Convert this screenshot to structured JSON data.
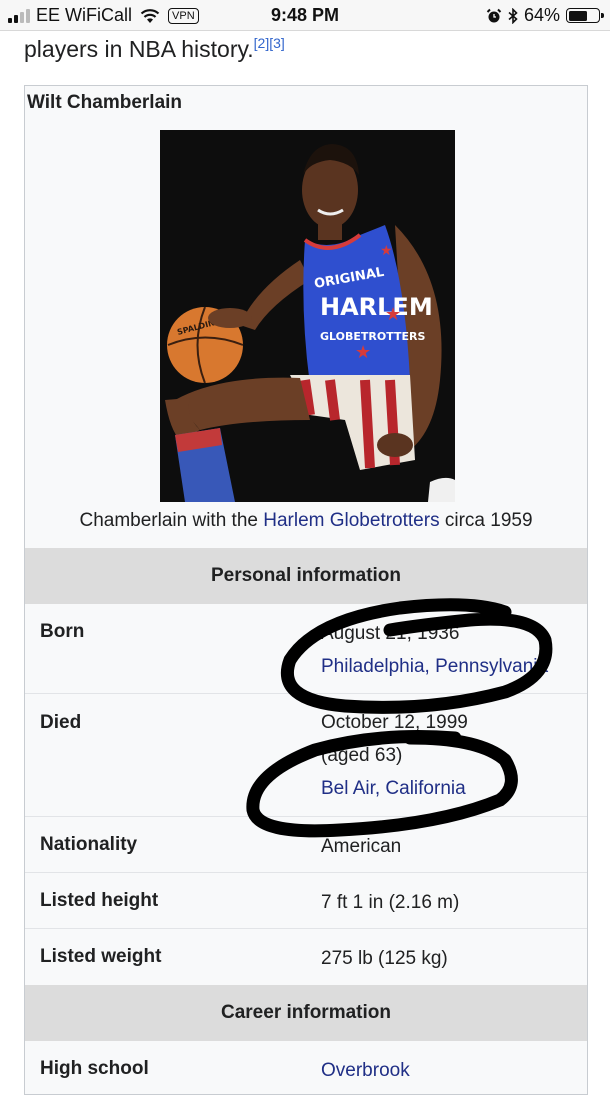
{
  "status_bar": {
    "carrier": "EE WiFiCall",
    "vpn_badge": "VPN",
    "time": "9:48 PM",
    "battery_percent": "64%",
    "battery_level": 0.64
  },
  "article": {
    "lead_text": "players in NBA history.",
    "citation": "[2][3]"
  },
  "infobox": {
    "title": "Wilt Chamberlain",
    "image": {
      "alt": "Chamberlain in a Harlem Globetrotters uniform holding a basketball",
      "jersey_lines": [
        "ORIGINAL",
        "HARLEM",
        "GLOBETROTTERS"
      ],
      "ball_brand": "SPALDING"
    },
    "caption": {
      "before": "Chamberlain with the ",
      "link": "Harlem Globetrotters",
      "after": " circa 1959"
    },
    "personal_header": "Personal information",
    "born": {
      "label": "Born",
      "date": "August 21, 1936",
      "place": "Philadelphia, Pennsylvania"
    },
    "died": {
      "label": "Died",
      "date": "October 12, 1999",
      "age": "(aged 63)",
      "place": "Bel Air, California"
    },
    "nationality": {
      "label": "Nationality",
      "value": "American"
    },
    "height": {
      "label": "Listed height",
      "value": "7 ft 1 in (2.16 m)"
    },
    "weight": {
      "label": "Listed weight",
      "value": "275 lb (125 kg)"
    },
    "career_header": "Career information",
    "high_school": {
      "label": "High school",
      "value": "Overbrook"
    }
  },
  "colors": {
    "link": "#202f86",
    "header_bg": "#dcdcdc",
    "infobox_bg": "#f8f9fa",
    "annotation_ink": "#000000"
  }
}
